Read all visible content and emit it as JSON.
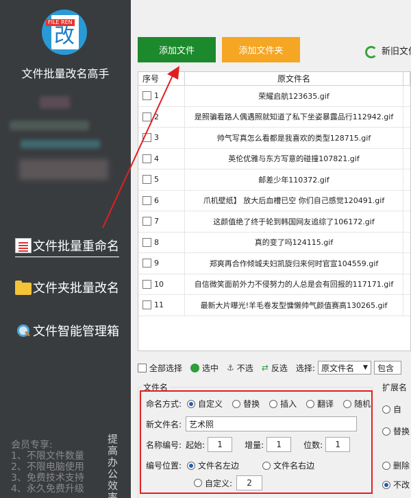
{
  "app": {
    "title": "文件批量改名高手",
    "logo_tag": "FILE REN",
    "logo_glyph": "改"
  },
  "sidebar": {
    "items": [
      {
        "label": "文件批量重命名",
        "icon": "document-icon"
      },
      {
        "label": "文件夹批量改名",
        "icon": "folder-icon"
      },
      {
        "label": "文件智能管理箱",
        "icon": "magnifier-icon"
      }
    ],
    "member_lines": [
      "会员专享:",
      "1、不限文件数量",
      "2、不限电脑使用",
      "3、免费技术支持",
      "4、永久免费升级"
    ],
    "slogan": "提高办公效率"
  },
  "toolbar_top": {
    "add_file": "添加文件",
    "add_folder": "添加文件夹",
    "new_old": "新旧文件"
  },
  "table": {
    "headers": [
      "序号",
      "原文件名"
    ],
    "rows": [
      {
        "num": "1",
        "name": "荣耀启航123635.gif"
      },
      {
        "num": "2",
        "name": "是照骗看路人偶遇照就知道了私下坐姿暴露品行112942.gif"
      },
      {
        "num": "3",
        "name": "帅气写真怎么看都是我喜欢的类型128715.gif"
      },
      {
        "num": "4",
        "name": "英伦优雅与东方写意的碰撞107821.gif"
      },
      {
        "num": "5",
        "name": "邮差少年110372.gif"
      },
      {
        "num": "6",
        "name": "爪机壁纸】 放大后血槽已空 你们自己感觉120491.gif"
      },
      {
        "num": "7",
        "name": "这颜值绝了终于轮到韩国网友追综了106172.gif"
      },
      {
        "num": "8",
        "name": "真的变了吗124115.gif"
      },
      {
        "num": "9",
        "name": "郑爽再合作倾城夫妇凯旋归来何时官宣104559.gif"
      },
      {
        "num": "10",
        "name": "自信微笑面前外力不侵努力的人总是会有回报的117171.gif"
      },
      {
        "num": "11",
        "name": "最新大片曝光!羊毛卷发型慵懒帅气颜值赛高130265.gif"
      }
    ]
  },
  "toolbar_bottom": {
    "select_all": "全部选择",
    "select": "选中",
    "deselect": "不选",
    "invert": "反选",
    "choose_label": "选择:",
    "choose_value": "原文件名",
    "contains": "包含"
  },
  "form": {
    "group_filename": "文件名",
    "group_ext": "扩展名",
    "naming_label": "命名方式:",
    "naming_options": [
      "自定义",
      "替换",
      "插入",
      "翻译",
      "随机"
    ],
    "new_name_label": "新文件名:",
    "new_name_value": "艺术照",
    "numbering_label": "名称编号:",
    "start_label": "起始:",
    "start_value": "1",
    "step_label": "增量:",
    "step_value": "1",
    "digits_label": "位数:",
    "digits_value": "1",
    "position_label": "编号位置:",
    "pos_left": "文件名左边",
    "pos_right": "文件名右边",
    "pos_custom": "自定义:",
    "pos_custom_value": "2",
    "ext_options": [
      "自",
      "替换",
      "删除",
      "不改"
    ]
  },
  "colors": {
    "sidebar": "#393c3f",
    "add_file": "#1c8a2c",
    "add_folder": "#f5a623",
    "highlight": "#e02020"
  }
}
